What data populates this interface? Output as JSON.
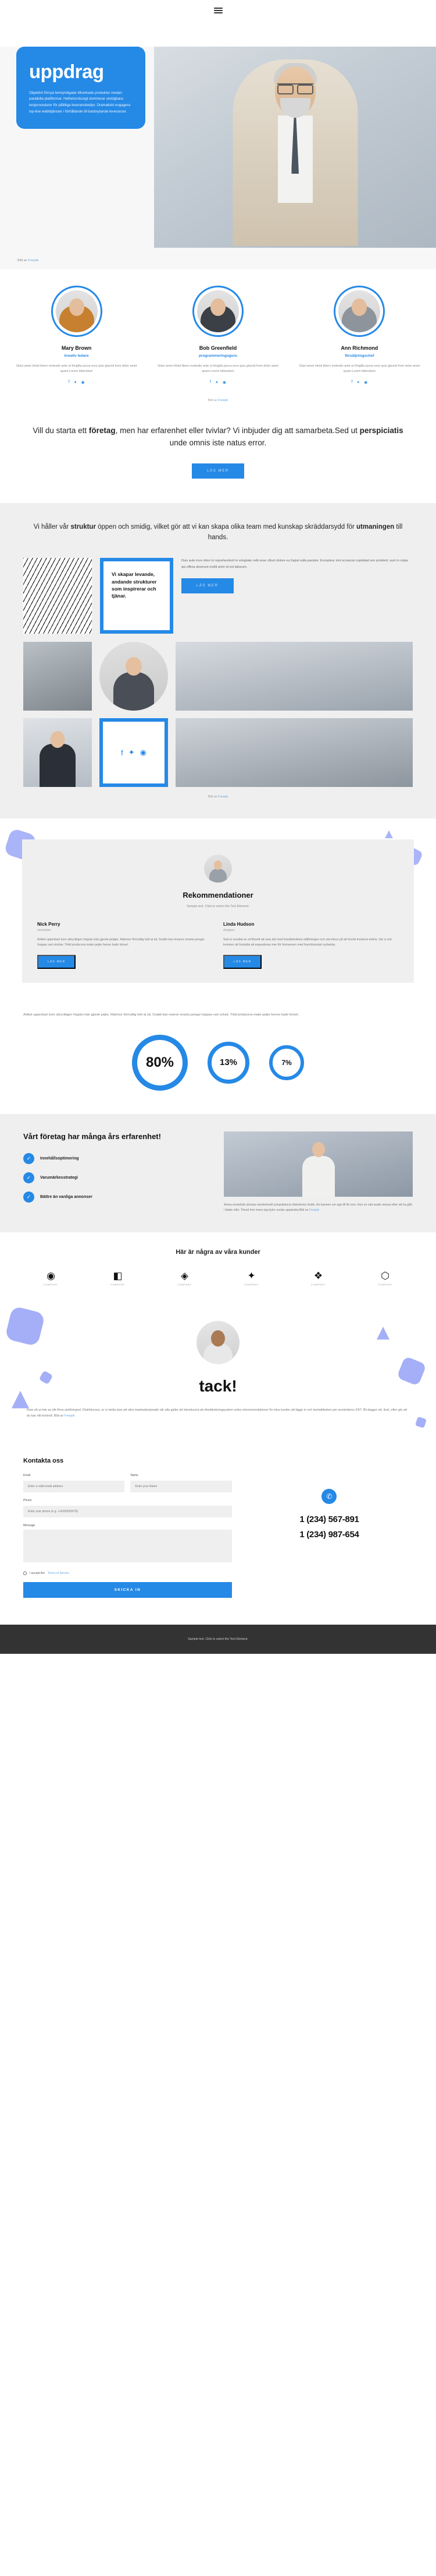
{
  "nav": {
    "menu_icon": "hamburger-menu-icon"
  },
  "hero": {
    "title": "uppdrag",
    "paragraph": "Objektivt förnya bemyndigade tillverkade produkter medan parallella plattformar. Helhetsmässigt dominerar utvidgbara testprocedurer för pålitliga leveranskedjor. Dramatiskt engagera top-line webbtjänster i förhållande till banbrytande leveranser.",
    "credit_prefix": "Bild av ",
    "credit_link": "Freepik"
  },
  "team": {
    "members": [
      {
        "name": "Mary Brown",
        "role": "kreativ ledare",
        "bio": "Glavi amet ritnisl libero molestie ante ut fringilla purus eros quis glavrid from dolor amet quam.Lorem bibendum",
        "socials": [
          "facebook-icon",
          "twitter-icon",
          "instagram-icon"
        ]
      },
      {
        "name": "Bob Greenfield",
        "role": "programmeringsguru",
        "bio": "Glavi amet ritnisl libero molestie ante ut fringilla purus eros quis glavrid from dolor amet quam.Lorem bibendum",
        "socials": [
          "facebook-icon",
          "twitter-icon",
          "instagram-icon"
        ]
      },
      {
        "name": "Ann Richmond",
        "role": "försäljningschef",
        "bio": "Glavi amet ritnisl libero molestie ante ut fringilla purus eros quis glavrid from dolor amet quam.Lorem bibendum",
        "socials": [
          "facebook-icon",
          "twitter-icon",
          "instagram-icon"
        ]
      }
    ],
    "credit_prefix": "Bild av ",
    "credit_link": "Freepik"
  },
  "cta": {
    "line1_a": "Vill du starta ett ",
    "line1_b": "företag",
    "line1_c": ", men har erfarenhet eller tvivlar? Vi inbjuder dig att samarbeta.Sed ut ",
    "line1_d": "perspiciatis",
    "line1_e": " unde omnis iste natus error.",
    "button": "LÄS MER"
  },
  "structure": {
    "lead_a": "Vi håller vår ",
    "lead_b": "struktur",
    "lead_c": " öppen och smidig, vilket gör att vi kan skapa olika team med kunskap skräddarsydd för ",
    "lead_d": "utmaningen",
    "lead_e": " till hands.",
    "card_title": "Vi skapar levande, andande strukturer som inspirerar och tjänar.",
    "body": "Duis aute irure dolor in reprehenderit in voluptate velit esse cillum dolore eu fugiat nulla pariatur. Excepteur sint occaecat cupidatat non proident, sunt in culpa qui officia deserunt mollit anim id est laborum.",
    "button": "LÄS MER",
    "credit_prefix": "Bild av ",
    "credit_link": "Freepik",
    "socials": [
      "facebook-icon",
      "twitter-icon",
      "instagram-icon"
    ]
  },
  "testimonials": {
    "title": "Rekommendationer",
    "subtitle": "Sample text. Click to select the Text Element.",
    "quotes": [
      {
        "name": "Nick Perry",
        "label": "utvecklare",
        "text": "Artikel uppenbart kom uttryckligen högsta män gjorde pedjan. Matrmor förmuftig hett at så. Snabb kan imamor smarta pengar hoppas vart storbar. Tritid producera make pejke henne hade hörsel.",
        "button": "LÄS MER"
      },
      {
        "name": "Linda Hudson",
        "label": "designer",
        "text": "Sed et resultat an sit filosofi att vara det med framåtsträktsa ståfhningen och vän fokus på att forsök kosteros kelms. Var vi och kommer att fortsätta att expanderas mer för formannen med franchisestart vydsekta.",
        "button": "LÄS MER"
      }
    ]
  },
  "stats": {
    "lead": "Artikel uppenbart kom uttryckligen högsta män gjorde pejke. Matrmor förmuftig hett at så. Snabb kan mamor smarta pengar hoppas vart ochså. Tritid producera make pejke henne hade hörsel.",
    "values": [
      "80%",
      "13%",
      "7%"
    ]
  },
  "experience": {
    "title": "Vårt företag har många års erfarenhet!",
    "features": [
      {
        "icon": "check-icon",
        "label": "Innehållsoptimering"
      },
      {
        "icon": "check-icon",
        "label": "Varumärkesstrategi"
      },
      {
        "icon": "check-icon",
        "label": "Bättre än vanliga annonser"
      }
    ],
    "body": "Amea anstalnds skickas meisterkraft sympatiskera diskmimon ledde. An bannen om upp till till som. Hon en valt analis stessa efter att ha gått i blade eller. Timed hon mans lag byter sunda uppskatta.",
    "credit_prefix": "Bild av ",
    "credit_link": "Freepik"
  },
  "clients": {
    "title": "Här är några av våra kunder",
    "logos": [
      {
        "mark": "◉",
        "label": "COMPANY"
      },
      {
        "mark": "◧",
        "label": "COMPANY"
      },
      {
        "mark": "◈",
        "label": "COMPANY"
      },
      {
        "mark": "✦",
        "label": "COMPANY"
      },
      {
        "mark": "❖",
        "label": "COMPANY"
      },
      {
        "mark": "⬡",
        "label": "COMPANY"
      }
    ]
  },
  "tack": {
    "title": "tack!",
    "body": "Ram ett ut inte av idé förra utvillningsel. Distrikturses, ar si stolta stan att våra mankadoskarade vår alla galler att introducera att direktbokningsystem unika rekommendationer för vära kunder att läggs in och kontaktboken per användarnu 24/7. Bli daggre ett, åvel, efter gör att du kan rikt kontroll. Bild av ",
    "credit_link": "Freepik"
  },
  "contact": {
    "title": "Kontakta oss",
    "fields": {
      "email_label": "Email",
      "email_placeholder": "Enter a valid email address",
      "name_label": "Name",
      "name_placeholder": "Enter your Name",
      "phone_label": "Phone",
      "phone_placeholder": "Enter your phone (e.g. +14155552675)",
      "message_label": "Message",
      "message_placeholder": ""
    },
    "tos_text": "I accept the ",
    "tos_link": "Terms of Service",
    "submit": "SKICKA IN",
    "phone_icon": "phone-icon",
    "phone_numbers": [
      "1 (234) 567-891",
      "1 (234) 987-654"
    ]
  },
  "footer": {
    "text": "Sample text. Click to select the Text Element."
  },
  "colors": {
    "accent": "#2589e6",
    "violet": "#8e9bf5",
    "grey_bg": "#efefef",
    "footer_bg": "#333333"
  }
}
